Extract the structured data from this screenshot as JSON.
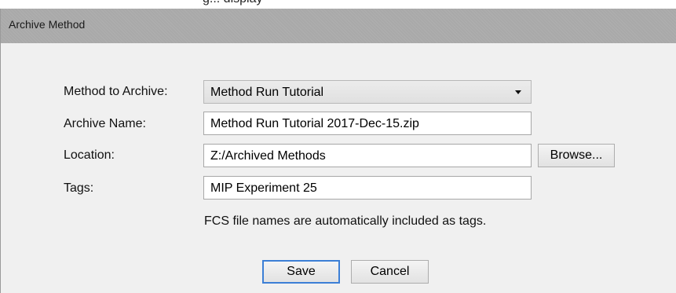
{
  "top_fragment": "g... display",
  "dialog": {
    "title": "Archive Method",
    "labels": {
      "method": "Method to Archive:",
      "archive_name": "Archive Name:",
      "location": "Location:",
      "tags": "Tags:"
    },
    "method_select": {
      "value": "Method Run Tutorial"
    },
    "archive_name_value": "Method Run Tutorial 2017-Dec-15.zip",
    "location_value": "Z:/Archived Methods",
    "tags_value": "MIP Experiment 25",
    "hint": "FCS file names are automatically included as tags.",
    "buttons": {
      "browse": "Browse...",
      "save": "Save",
      "cancel": "Cancel"
    }
  },
  "colors": {
    "titlebar": "#a9a9a9",
    "background": "#f0f0f0",
    "default_button_border": "#3c7fd6"
  },
  "icons": {
    "dropdown": "chevron-down-icon"
  }
}
